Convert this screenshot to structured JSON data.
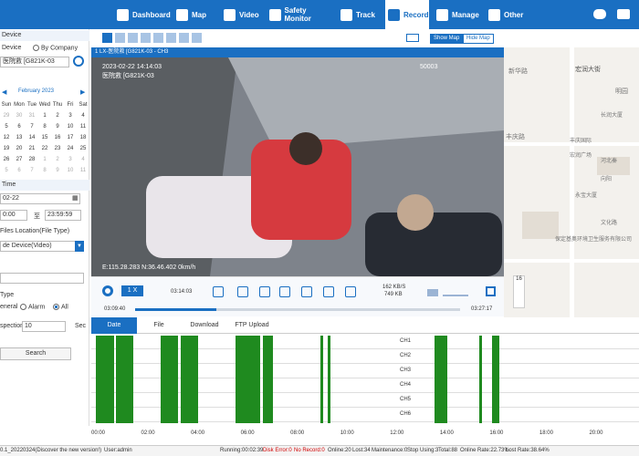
{
  "nav": {
    "items": [
      {
        "label": "Dashboard",
        "icon": "dashboard-icon"
      },
      {
        "label": "Map",
        "icon": "map-icon"
      },
      {
        "label": "Video",
        "icon": "video-icon"
      },
      {
        "label": "Safety Monitor",
        "icon": "shield-icon"
      },
      {
        "label": "Track",
        "icon": "track-icon"
      },
      {
        "label": "Record",
        "icon": "record-icon"
      },
      {
        "label": "Manage",
        "icon": "manage-icon"
      },
      {
        "label": "Other",
        "icon": "grid-icon"
      }
    ],
    "active": "Record"
  },
  "left": {
    "device_head": "Device",
    "by_device": "Device",
    "by_company": "By Company",
    "device_value": "医院救 [G821K-03",
    "calendar_title": "February 2023",
    "weekdays": [
      "Sun",
      "Mon",
      "Tue",
      "Wed",
      "Thu",
      "Fri",
      "Sat"
    ],
    "calendar_days": [
      "29",
      "30",
      "31",
      "1",
      "2",
      "3",
      "4",
      "5",
      "6",
      "7",
      "8",
      "9",
      "10",
      "11",
      "12",
      "13",
      "14",
      "15",
      "16",
      "17",
      "18",
      "19",
      "20",
      "21",
      "22",
      "23",
      "24",
      "25",
      "26",
      "27",
      "28",
      "1",
      "2",
      "3",
      "4",
      "5",
      "6",
      "7",
      "8",
      "9",
      "10",
      "11"
    ],
    "time_head": "Time",
    "date_value": "02-22",
    "start_time": "0:00",
    "to_label": "至",
    "end_time": "23:59:59",
    "files_location_label": "Files Location(File Type)",
    "files_location_value": "de Device(Video)",
    "type_head": "Type",
    "type_general": "eneral",
    "type_alarm": "Alarm",
    "type_all": "All",
    "inspection_label": "spection",
    "inspection_value": "10",
    "inspection_unit": "Sec",
    "search_label": "Search"
  },
  "video": {
    "title": "1 LX-医院救 [G821K-03 - CH3",
    "osd_top": "2023-02-22  14:14:03",
    "osd_num": "50003",
    "osd_bottom": "E:115.28.283  N:36.46.402  0km/h",
    "osd_name": "医院救 [G821K-03"
  },
  "controls": {
    "speed": "1 X",
    "current_time": "03:14:03",
    "bitrate": "162 KB/S",
    "size": "749 KB",
    "start": "03:09:40",
    "end": "03:27:17",
    "progress": 0.25
  },
  "map": {
    "show_map": "Show Map",
    "hide_map": "Hide Map",
    "zoom": "16",
    "labels": [
      "新华路",
      "宏润大街",
      "明园",
      "丰庆路",
      "长润大厦",
      "丰庆国际",
      "宏润广场",
      "永宝大厦",
      "河北秦",
      "保定基奥环境卫生服务有限公司",
      "文化路",
      "向阳"
    ]
  },
  "record_tabs": [
    "Date",
    "File",
    "Download",
    "FTP Upload"
  ],
  "timeline": {
    "channels": [
      "CH1",
      "CH2",
      "CH3",
      "CH4",
      "CH5",
      "CH6"
    ],
    "ticks": [
      "00:00",
      "02:00",
      "04:00",
      "06:00",
      "08:00",
      "10:00",
      "12:00",
      "14:00",
      "16:00",
      "18:00",
      "20:00"
    ],
    "segments_hours": [
      [
        0.2,
        0.9
      ],
      [
        1.0,
        1.7
      ],
      [
        2.8,
        3.5
      ],
      [
        3.6,
        4.3
      ],
      [
        5.8,
        6.8
      ],
      [
        6.9,
        7.3
      ],
      [
        9.2,
        9.3
      ],
      [
        9.5,
        9.6
      ],
      [
        13.8,
        14.3
      ],
      [
        15.6,
        15.7
      ],
      [
        16.1,
        16.4
      ]
    ]
  },
  "status": {
    "version": "0.1_20220324(Discover the new version!)",
    "user": "User:admin",
    "running": "Running:00:02:39",
    "disk_error": "Disk Error:0",
    "no_record": "No Record:0",
    "online": "Online:20",
    "lost": "Lost:34",
    "maintenance": "Maintenance:0",
    "stop_using": "Stop Using:3",
    "total": "Total:88",
    "online_rate": "Online Rate:22.73%",
    "lost_rate": "Lost Rate:38.64%"
  },
  "colors": {
    "brand": "#1a6fc2",
    "record_bar": "#1f8a1f",
    "error": "#d00000"
  }
}
